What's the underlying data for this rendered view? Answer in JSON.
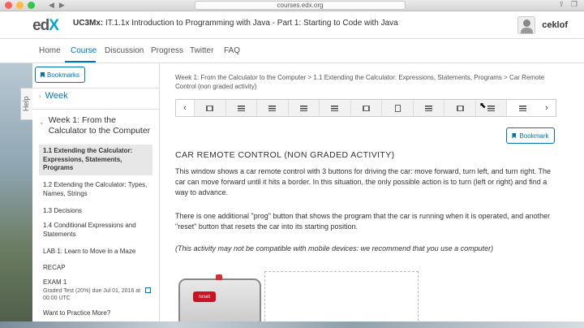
{
  "browser": {
    "url": "courses.edx.org"
  },
  "header": {
    "logo_e": "e",
    "logo_d": "d",
    "logo_x": "X",
    "course_code": "UC3Mx:",
    "course_name": "IT.1.1x Introduction to Programming with Java - Part 1: Starting to Code with Java",
    "username": "ceklof"
  },
  "tabs": [
    "Home",
    "Course",
    "Discussion",
    "Progress",
    "Twitter",
    "FAQ"
  ],
  "help_label": "Help",
  "sidebar": {
    "bookmarks_label": "Bookmarks",
    "week_link": "Week",
    "section_title": "Week 1: From the Calculator to the Computer",
    "items": [
      {
        "label": "1.1 Extending the Calculator: Expressions, Statements, Programs"
      },
      {
        "label": "1.2 Extending the Calculator: Types, Names, Strings"
      },
      {
        "label": "1.3 Decisions"
      },
      {
        "label": "1.4 Conditional Expressions and Statements"
      },
      {
        "label": "LAB 1: Learn to Move in a Maze"
      },
      {
        "label": "RECAP"
      },
      {
        "label": "EXAM 1",
        "meta": "Graded Test (20%) due Jul 01, 2016 at 00:00 UTC"
      },
      {
        "label": "Want to Practice More?"
      }
    ]
  },
  "content": {
    "breadcrumb": "Week 1: From the Calculator to the Computer > 1.1 Extending the Calculator: Expressions, Statements, Programs > Car Remote Control (non graded activity)",
    "bookmark_label": "Bookmark",
    "unit_title": "Car Remote Control (non graded activity)",
    "para1": "This window shows a car remote control with 3 buttons for driving the car: move forward, turn left, and turn right. The car can move forward until it hits a border. In this situation, the only possible action is to turn (left or right) and find a way to advance.",
    "para2": "There is one additional \"prog\" button that shows the program that the car is running when it is operated, and another \"reset\" button that resets the car into its starting position.",
    "para3": "(This activity may not be compatible with mobile devices: we recommend that you use a computer)",
    "reset_label": "reset"
  },
  "sequence_icons": [
    "film-icon",
    "list-icon",
    "list-icon",
    "list-icon",
    "list-icon",
    "film-icon",
    "doc-icon",
    "list-icon",
    "film-icon",
    "list-icon",
    "list-icon"
  ],
  "colors": {
    "accent": "#0075b4",
    "logo_x": "#02a2dc",
    "reset": "#cc1122"
  }
}
